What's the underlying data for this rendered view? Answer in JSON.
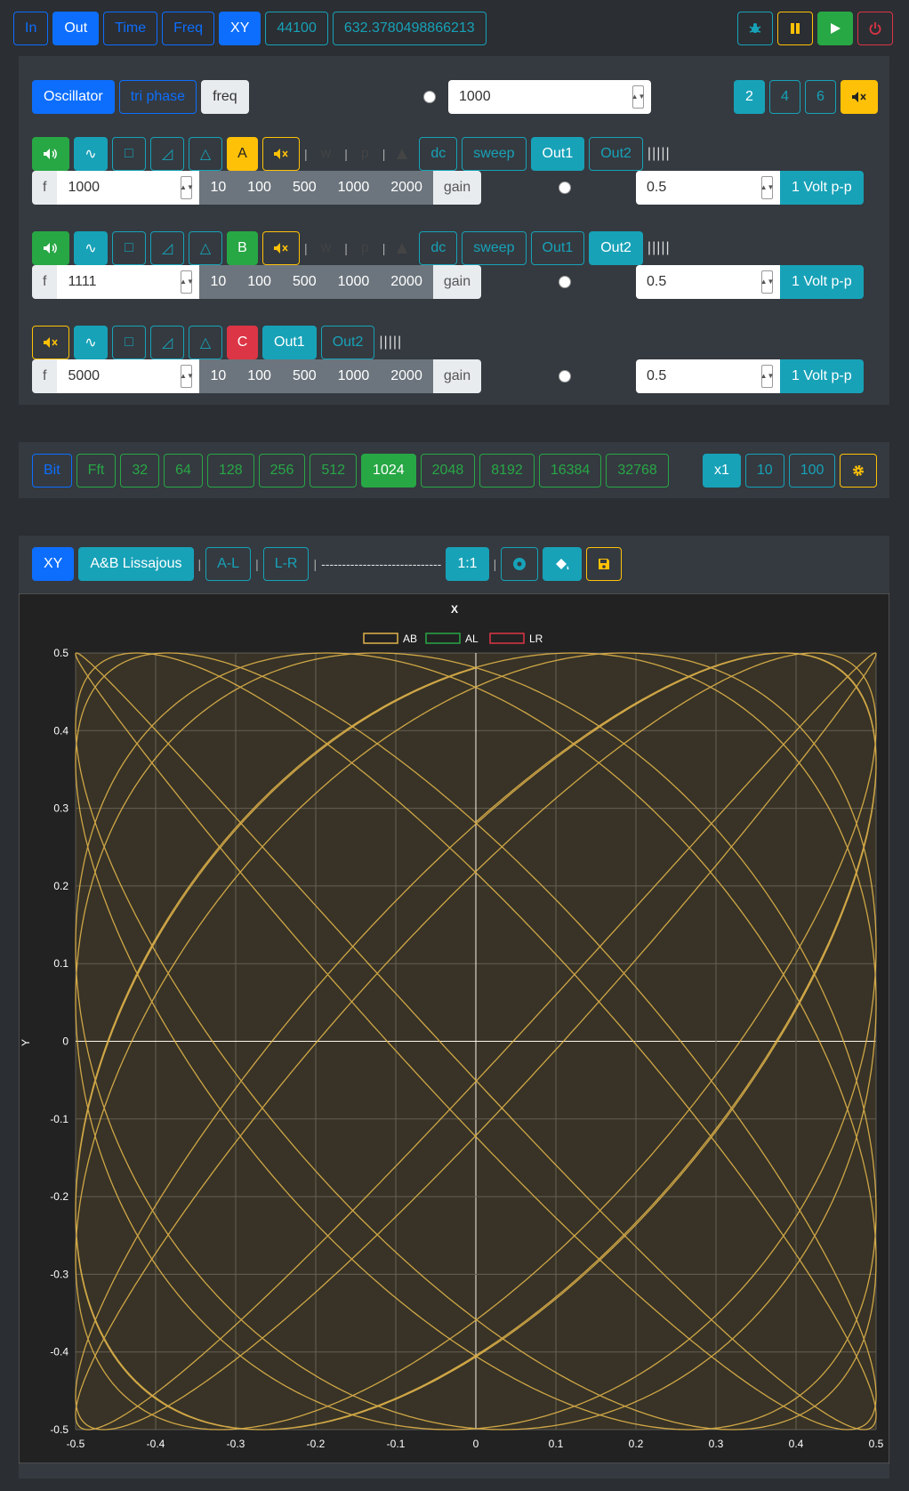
{
  "topbar": {
    "tabs": [
      "In",
      "Out",
      "Time",
      "Freq",
      "XY"
    ],
    "sample_rate": "44100",
    "value": "632.3780498866213"
  },
  "osc": {
    "mode_buttons": [
      "Oscillator",
      "tri phase",
      "freq"
    ],
    "freq_value": "1000",
    "count_buttons": [
      "2",
      "4",
      "6"
    ],
    "channels": [
      {
        "label": "A",
        "sym_sine": "∿",
        "sym_square": "□",
        "sym_saw": "◿",
        "sym_tri": "△",
        "w": "w",
        "p": "p",
        "dc": "dc",
        "sweep": "sweep",
        "out1": "Out1",
        "out2": "Out2",
        "ticks": "|||||",
        "f": "f",
        "freq": "1000",
        "steps": [
          "10",
          "100",
          "500",
          "1000",
          "2000"
        ],
        "gain": "gain",
        "amp": "0.5",
        "volt": "1 Volt p-p"
      },
      {
        "label": "B",
        "sym_sine": "∿",
        "sym_square": "□",
        "sym_saw": "◿",
        "sym_tri": "△",
        "w": "w",
        "p": "p",
        "dc": "dc",
        "sweep": "sweep",
        "out1": "Out1",
        "out2": "Out2",
        "ticks": "|||||",
        "f": "f",
        "freq": "1111",
        "steps": [
          "10",
          "100",
          "500",
          "1000",
          "2000"
        ],
        "gain": "gain",
        "amp": "0.5",
        "volt": "1 Volt p-p"
      },
      {
        "label": "C",
        "sym_sine": "∿",
        "sym_square": "□",
        "sym_saw": "◿",
        "sym_tri": "△",
        "out1": "Out1",
        "out2": "Out2",
        "ticks": "|||||",
        "f": "f",
        "freq": "5000",
        "steps": [
          "10",
          "100",
          "500",
          "1000",
          "2000"
        ],
        "gain": "gain",
        "amp": "0.5",
        "volt": "1 Volt p-p"
      }
    ]
  },
  "fft": {
    "buttons": [
      "Bit",
      "Fft",
      "32",
      "64",
      "128",
      "256",
      "512",
      "1024",
      "2048",
      "8192",
      "16384",
      "32768"
    ],
    "active": "1024",
    "scale": [
      "x1",
      "10",
      "100"
    ]
  },
  "xy": {
    "buttons": {
      "xy": "XY",
      "lissajous": "A&B Lissajous",
      "al": "A-L",
      "lr": "L-R",
      "dashes": "-----------------------------",
      "ratio": "1:1"
    }
  },
  "colors": {
    "ab": "#e0b24a",
    "al": "#28a745",
    "lr": "#dc3545",
    "accent": "#17a2b8",
    "primary": "#0d6efd"
  },
  "chart_data": {
    "type": "scatter",
    "title": "X",
    "ylabel": "Y",
    "xlim": [
      -0.5,
      0.5
    ],
    "ylim": [
      -0.5,
      0.5
    ],
    "x_ticks": [
      "-0.5",
      "-0.4",
      "-0.3",
      "-0.2",
      "-0.1",
      "0",
      "0.1",
      "0.2",
      "0.3",
      "0.4",
      "0.5"
    ],
    "y_ticks": [
      "0.5",
      "0.4",
      "0.3",
      "0.2",
      "0.1",
      "0",
      "-0.1",
      "-0.2",
      "-0.3",
      "-0.4",
      "-0.5"
    ],
    "legend": [
      "AB",
      "AL",
      "LR"
    ],
    "legend_position": "top-center",
    "grid": true,
    "series": [
      {
        "name": "AB",
        "x_freq": 1000,
        "y_freq": 1111,
        "amplitude": 0.5
      }
    ]
  }
}
